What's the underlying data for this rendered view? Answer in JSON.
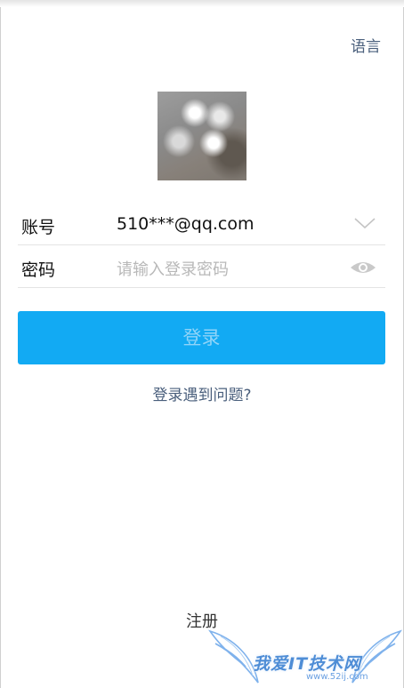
{
  "header": {
    "language_label": "语言"
  },
  "account_row": {
    "label": "账号",
    "value": "510***@qq.com"
  },
  "password_row": {
    "label": "密码",
    "placeholder": "请输入登录密码"
  },
  "login_button": {
    "label": "登录"
  },
  "help_link": {
    "label": "登录遇到问题?"
  },
  "register_link": {
    "label": "注册"
  },
  "watermark": {
    "main": "我爱IT技术网",
    "url": "www.52ij.com"
  },
  "icons": {
    "dropdown": "chevron-down-icon",
    "password_visibility": "eye-icon"
  },
  "colors": {
    "primary_button": "#12aaf3",
    "button_text": "#8fd4f8",
    "link": "#4a5f7c",
    "watermark": "#4e8dd6"
  }
}
